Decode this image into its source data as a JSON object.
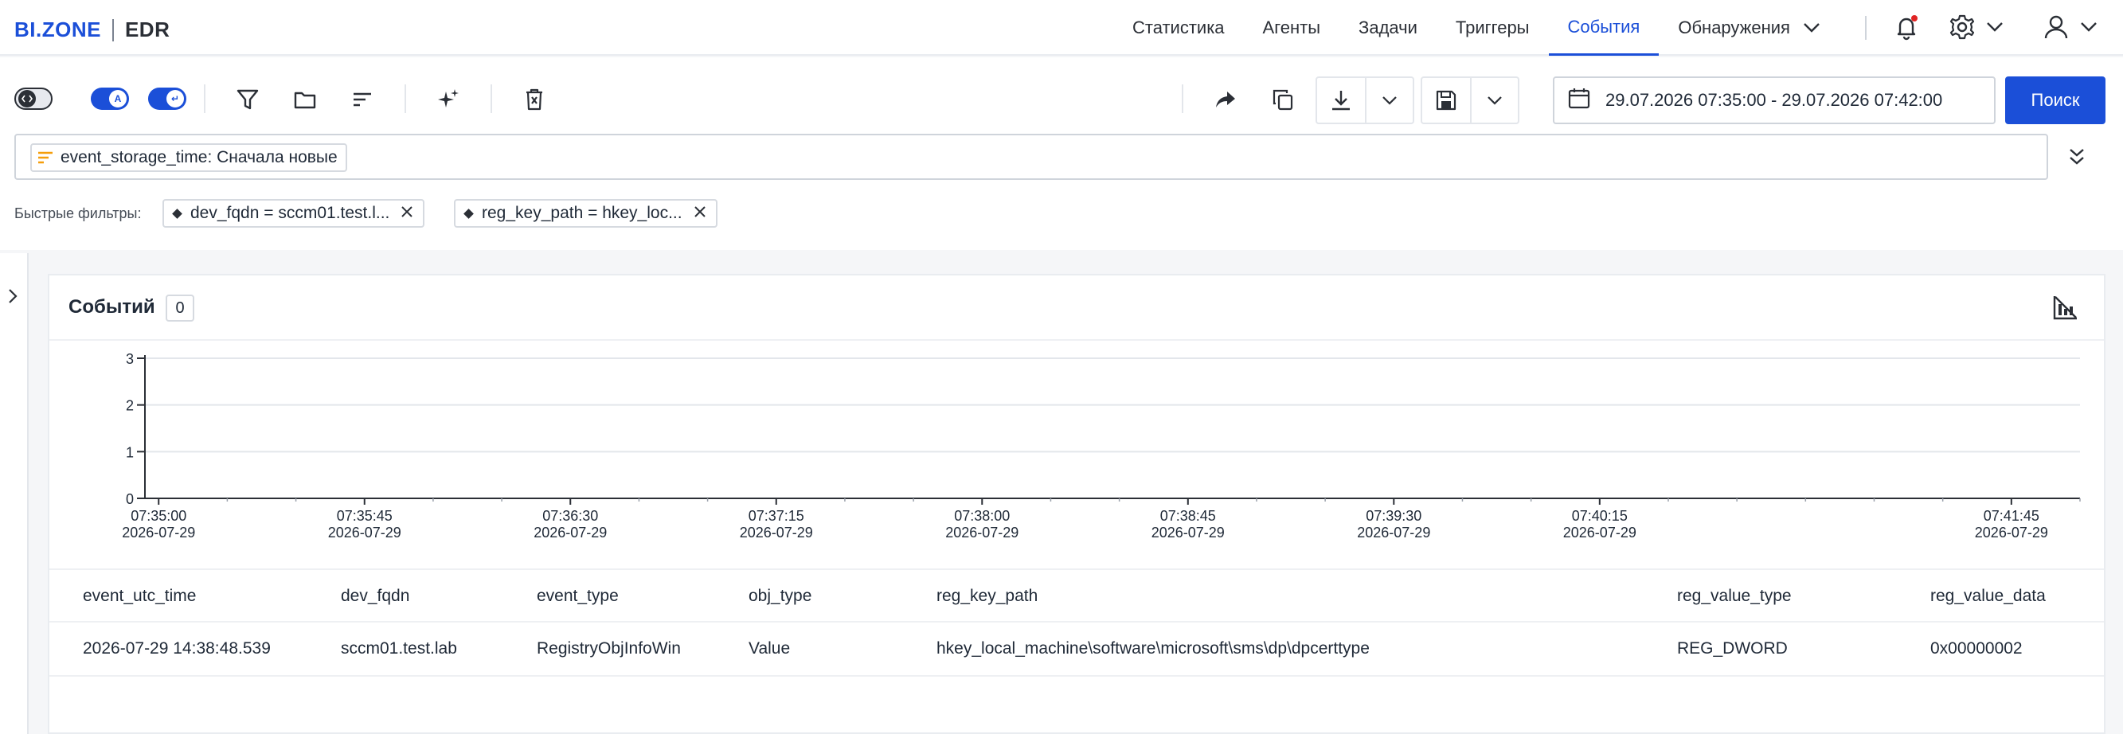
{
  "app": {
    "logo_left": "BI.ZONE",
    "logo_right": "EDR"
  },
  "nav": {
    "items": [
      {
        "label": "Статистика",
        "active": false
      },
      {
        "label": "Агенты",
        "active": false
      },
      {
        "label": "Задачи",
        "active": false
      },
      {
        "label": "Триггеры",
        "active": false
      },
      {
        "label": "События",
        "active": true
      },
      {
        "label": "Обнаружения",
        "active": false,
        "has_dropdown": true
      }
    ],
    "icons": [
      "bell-icon",
      "gear-icon",
      "user-icon"
    ],
    "accent_color": "#1b4fd8",
    "notification_dot_color": "#e02424"
  },
  "toolbar": {
    "toggles": [
      {
        "name": "code-toggle",
        "state": "off",
        "icon": "code-icon"
      },
      {
        "name": "autocomplete-toggle",
        "state": "on",
        "glyph": "A"
      },
      {
        "name": "wrap-toggle",
        "state": "on",
        "glyph": "↵"
      }
    ],
    "tools": [
      "filter-icon",
      "folder-icon",
      "sort-icon",
      "sparkle-icon",
      "clear-icon"
    ],
    "actions": [
      "share-icon",
      "copy-icon",
      "download-icon",
      "save-icon"
    ],
    "date_range": "29.07.2026 07:35:00 - 29.07.2026 07:42:00",
    "search_label": "Поиск"
  },
  "sort": {
    "chip": "event_storage_time: Сначала новые"
  },
  "quick_filters": {
    "label": "Быстрые фильтры:",
    "chips": [
      "dev_fqdn = sccm01.test.l...",
      "reg_key_path = hkey_loc..."
    ]
  },
  "panel": {
    "title": "Событий",
    "count": "0"
  },
  "chart_data": {
    "type": "bar",
    "title": "",
    "xlabel": "",
    "ylabel": "",
    "ylim": [
      0,
      3
    ],
    "y_ticks": [
      "0",
      "1",
      "2",
      "3"
    ],
    "x_ticks": [
      {
        "time": "07:35:00",
        "date": "2026-07-29"
      },
      {
        "time": "07:35:45",
        "date": "2026-07-29"
      },
      {
        "time": "07:36:30",
        "date": "2026-07-29"
      },
      {
        "time": "07:37:15",
        "date": "2026-07-29"
      },
      {
        "time": "07:38:00",
        "date": "2026-07-29"
      },
      {
        "time": "07:38:45",
        "date": "2026-07-29"
      },
      {
        "time": "07:39:30",
        "date": "2026-07-29"
      },
      {
        "time": "07:40:15",
        "date": "2026-07-29"
      },
      {
        "time": "07:41:45",
        "date": "2026-07-29"
      }
    ],
    "values": [],
    "grid": true
  },
  "table": {
    "columns": [
      "event_utc_time",
      "dev_fqdn",
      "event_type",
      "obj_type",
      "reg_key_path",
      "reg_value_type",
      "reg_value_data"
    ],
    "rows": [
      [
        "2026-07-29 14:38:48.539",
        "sccm01.test.lab",
        "RegistryObjInfoWin",
        "Value",
        "hkey_local_machine\\software\\microsoft\\sms\\dp\\dpcerttype",
        "REG_DWORD",
        "0x00000002"
      ]
    ]
  }
}
